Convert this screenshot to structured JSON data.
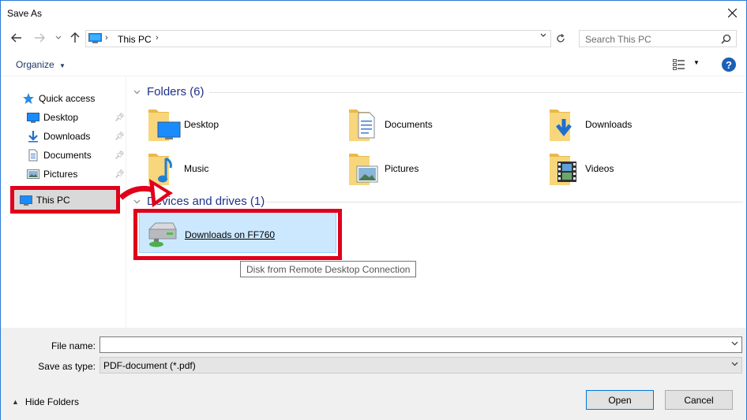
{
  "window": {
    "title": "Save As"
  },
  "address": {
    "crumb": "This PC"
  },
  "search": {
    "placeholder": "Search This PC"
  },
  "toolbar": {
    "organize_label": "Organize"
  },
  "sidebar": {
    "items": [
      {
        "label": "Quick access",
        "icon": "star-icon"
      },
      {
        "label": "Desktop",
        "icon": "desktop-icon",
        "pinned": true
      },
      {
        "label": "Downloads",
        "icon": "download-arrow-icon",
        "pinned": true
      },
      {
        "label": "Documents",
        "icon": "document-icon",
        "pinned": true
      },
      {
        "label": "Pictures",
        "icon": "pictures-icon",
        "pinned": true
      },
      {
        "label": "This PC",
        "icon": "computer-icon"
      }
    ]
  },
  "main": {
    "folders_header": "Folders (6)",
    "folders": [
      {
        "label": "Desktop"
      },
      {
        "label": "Documents"
      },
      {
        "label": "Downloads"
      },
      {
        "label": "Music"
      },
      {
        "label": "Pictures"
      },
      {
        "label": "Videos"
      }
    ],
    "devices_header": "Devices and drives (1)",
    "drive": {
      "label": "Downloads on FF760"
    },
    "tooltip": "Disk from Remote Desktop Connection"
  },
  "bottom": {
    "filename_label": "File name:",
    "filename_value": "",
    "savetype_label": "Save as type:",
    "savetype_value": "PDF-document (*.pdf)",
    "hide_folders": "Hide Folders",
    "open_label": "Open",
    "cancel_label": "Cancel"
  },
  "colors": {
    "annotation": "#e0001b",
    "selection": "#cce8ff",
    "accent": "#0078d7"
  }
}
